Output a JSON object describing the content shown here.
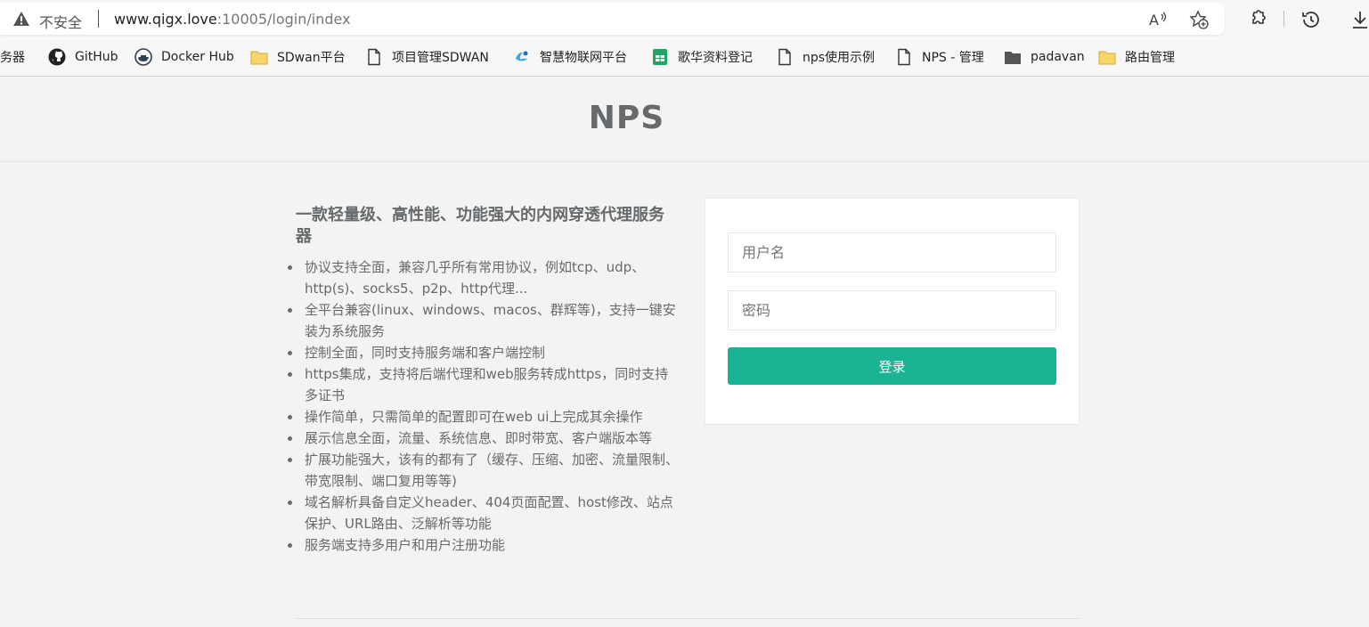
{
  "browser": {
    "security_label": "不安全",
    "url_host": "www.qigx.love",
    "url_rest": ":10005/login/index",
    "read_aloud_icon": "read-aloud-icon",
    "favorite_icon": "add-favorite-icon",
    "toolbar_icons": [
      "extensions-icon",
      "history-icon",
      "downloads-icon"
    ]
  },
  "bookmarks": [
    {
      "label": "务器",
      "icon": "none"
    },
    {
      "label": "GitHub",
      "icon": "github-icon"
    },
    {
      "label": "Docker Hub",
      "icon": "docker-icon"
    },
    {
      "label": "SDwan平台",
      "icon": "folder-icon"
    },
    {
      "label": "项目管理SDWAN",
      "icon": "page-icon"
    },
    {
      "label": "智慧物联网平台",
      "icon": "iot-icon"
    },
    {
      "label": "歌华资料登记",
      "icon": "sheets-icon"
    },
    {
      "label": "nps使用示例",
      "icon": "page-icon"
    },
    {
      "label": "NPS - 管理",
      "icon": "page-icon"
    },
    {
      "label": "padavan",
      "icon": "folder-dark-icon"
    },
    {
      "label": "路由管理",
      "icon": "folder-icon"
    }
  ],
  "header": {
    "logo": "NPS"
  },
  "intro": {
    "title": "一款轻量级、高性能、功能强大的内网穿透代理服务器",
    "features": [
      "协议支持全面，兼容几乎所有常用协议，例如tcp、udp、http(s)、socks5、p2p、http代理...",
      "全平台兼容(linux、windows、macos、群辉等)，支持一键安装为系统服务",
      "控制全面，同时支持服务端和客户端控制",
      "https集成，支持将后端代理和web服务转成https，同时支持多证书",
      "操作简单，只需简单的配置即可在web ui上完成其余操作",
      "展示信息全面，流量、系统信息、即时带宽、客户端版本等",
      "扩展功能强大，该有的都有了（缓存、压缩、加密、流量限制、带宽限制、端口复用等等)",
      "域名解析具备自定义header、404页面配置、host修改、站点保护、URL路由、泛解析等功能",
      "服务端支持多用户和用户注册功能"
    ]
  },
  "login": {
    "username_placeholder": "用户名",
    "password_placeholder": "密码",
    "submit_label": "登录"
  },
  "colors": {
    "accent": "#1ab394",
    "text": "#676a6c",
    "background": "#f3f3f3"
  }
}
